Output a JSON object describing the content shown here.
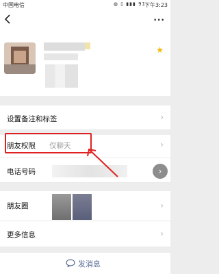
{
  "status_bar": {
    "carrier": "中国电信",
    "icons_text": "◍ ▯ ▮▮▮ 91",
    "time": "下午3:23"
  },
  "topbar": {
    "back_icon": "back-arrow-icon",
    "more_label": "···"
  },
  "profile": {
    "star_label": "★"
  },
  "rows": {
    "remark_label": "设置备注和标签",
    "permission_label": "朋友权限",
    "permission_value": "仅聊天",
    "phone_label": "电话号码",
    "moments_label": "朋友圈",
    "more_info_label": "更多信息",
    "chevron": "›"
  },
  "send": {
    "label": "发消息"
  },
  "colors": {
    "highlight": "#e02020",
    "link_blue": "#576b95",
    "star": "#f6b800"
  }
}
